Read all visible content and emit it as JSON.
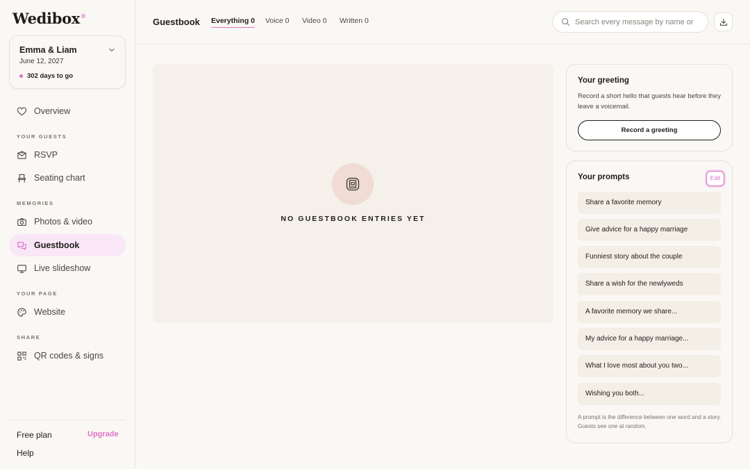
{
  "app": {
    "logo": "Wedibox",
    "logo_mark": "®"
  },
  "event": {
    "name": "Emma & Liam",
    "date": "June 12, 2027",
    "countdown": "302 days to go"
  },
  "sidebar": {
    "overview": "Overview",
    "sections": {
      "guests": "YOUR GUESTS",
      "memories": "MEMORIES",
      "page": "YOUR PAGE",
      "share": "SHARE"
    },
    "items": {
      "rsvp": "RSVP",
      "seating": "Seating chart",
      "photos": "Photos & video",
      "guestbook": "Guestbook",
      "slideshow": "Live slideshow",
      "website": "Website",
      "qr": "QR codes & signs"
    },
    "footer": {
      "plan": "Free plan",
      "upgrade": "Upgrade",
      "help": "Help"
    }
  },
  "header": {
    "title": "Guestbook",
    "tabs": [
      {
        "label": "Everything 0",
        "active": true
      },
      {
        "label": "Voice 0",
        "active": false
      },
      {
        "label": "Video 0",
        "active": false
      },
      {
        "label": "Written 0",
        "active": false
      }
    ],
    "search_placeholder": "Search every message by name or"
  },
  "main": {
    "empty_text": "NO GUESTBOOK ENTRIES YET"
  },
  "greeting": {
    "title": "Your greeting",
    "description": "Record a short hello that guests hear before they leave a voicemail.",
    "button": "Record a greeting"
  },
  "prompts": {
    "title": "Your prompts",
    "edit": "Edit",
    "items": [
      "Share a favorite memory",
      "Give advice for a happy marriage",
      "Funniest story about the couple",
      "Share a wish for the newlyweds",
      "A favorite memory we share...",
      "My advice for a happy marriage...",
      "What I love most about you two...",
      "Wishing you both..."
    ],
    "note": "A prompt is the difference between one word and a story. Guests see one at random."
  },
  "colors": {
    "accent": "#d96fc9",
    "active_bg": "#f9e6f6",
    "background": "#faf8f4"
  }
}
